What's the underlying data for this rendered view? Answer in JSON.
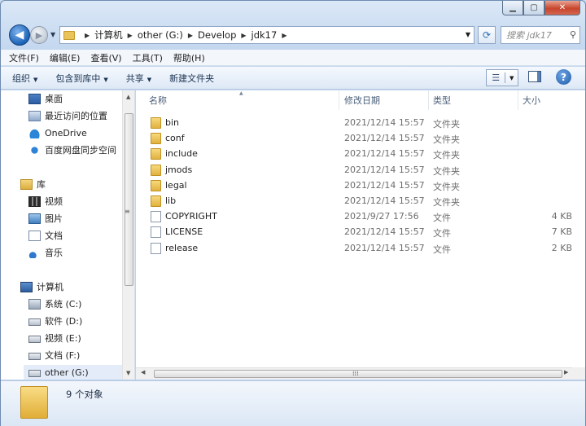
{
  "address": {
    "segments": [
      "计算机",
      "other (G:)",
      "Develop",
      "jdk17"
    ]
  },
  "search": {
    "placeholder": "搜索 jdk17"
  },
  "menu": [
    "文件(F)",
    "编辑(E)",
    "查看(V)",
    "工具(T)",
    "帮助(H)"
  ],
  "toolbar": {
    "organize": "组织",
    "include": "包含到库中",
    "share": "共享",
    "new_folder": "新建文件夹"
  },
  "nav": {
    "favorites": [
      {
        "label": "桌面",
        "icon": "desktop-icon"
      },
      {
        "label": "最近访问的位置",
        "icon": "recent-places-icon"
      },
      {
        "label": "OneDrive",
        "icon": "onedrive-icon"
      },
      {
        "label": "百度网盘同步空间",
        "icon": "baidu-netdisk-icon"
      }
    ],
    "libraries": {
      "label": "库",
      "items": [
        {
          "label": "视频",
          "icon": "video-library-icon"
        },
        {
          "label": "图片",
          "icon": "picture-library-icon"
        },
        {
          "label": "文档",
          "icon": "document-library-icon"
        },
        {
          "label": "音乐",
          "icon": "music-library-icon"
        }
      ]
    },
    "computer": {
      "label": "计算机",
      "items": [
        {
          "label": "系统 (C:)",
          "icon": "system-drive-icon"
        },
        {
          "label": "软件 (D:)",
          "icon": "drive-icon"
        },
        {
          "label": "视频 (E:)",
          "icon": "drive-icon"
        },
        {
          "label": "文档 (F:)",
          "icon": "drive-icon"
        },
        {
          "label": "other (G:)",
          "icon": "drive-icon"
        }
      ]
    }
  },
  "columns": {
    "name": "名称",
    "date": "修改日期",
    "type": "类型",
    "size": "大小"
  },
  "files": [
    {
      "name": "bin",
      "date": "2021/12/14 15:57",
      "type": "文件夹",
      "size": "",
      "kind": "folder"
    },
    {
      "name": "conf",
      "date": "2021/12/14 15:57",
      "type": "文件夹",
      "size": "",
      "kind": "folder"
    },
    {
      "name": "include",
      "date": "2021/12/14 15:57",
      "type": "文件夹",
      "size": "",
      "kind": "folder"
    },
    {
      "name": "jmods",
      "date": "2021/12/14 15:57",
      "type": "文件夹",
      "size": "",
      "kind": "folder"
    },
    {
      "name": "legal",
      "date": "2021/12/14 15:57",
      "type": "文件夹",
      "size": "",
      "kind": "folder"
    },
    {
      "name": "lib",
      "date": "2021/12/14 15:57",
      "type": "文件夹",
      "size": "",
      "kind": "folder"
    },
    {
      "name": "COPYRIGHT",
      "date": "2021/9/27 17:56",
      "type": "文件",
      "size": "4 KB",
      "kind": "file"
    },
    {
      "name": "LICENSE",
      "date": "2021/12/14 15:57",
      "type": "文件",
      "size": "7 KB",
      "kind": "file"
    },
    {
      "name": "release",
      "date": "2021/12/14 15:57",
      "type": "文件",
      "size": "2 KB",
      "kind": "file"
    }
  ],
  "status": {
    "count": "9 个对象"
  }
}
